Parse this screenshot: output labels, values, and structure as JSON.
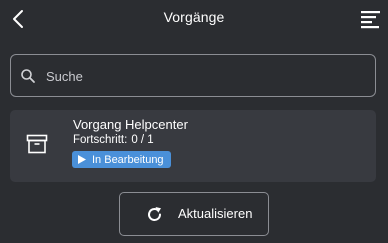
{
  "header": {
    "title": "Vorgänge",
    "back_icon": "chevron-left-icon",
    "menu_icon": "sort-menu-icon"
  },
  "search": {
    "placeholder": "Suche",
    "value": "",
    "icon": "search-icon"
  },
  "items": [
    {
      "title": "Vorgang Helpcenter",
      "progress_label": "Fortschritt:",
      "progress_value": "0 / 1",
      "status": "In Bearbeitung",
      "status_color": "#4a90d9",
      "icon": "archive-box-icon"
    }
  ],
  "actions": {
    "refresh_label": "Aktualisieren",
    "refresh_icon": "refresh-icon"
  },
  "colors": {
    "background": "#2b2d31",
    "card": "#383a40",
    "border": "#8b8d93",
    "accent": "#4a90d9"
  }
}
